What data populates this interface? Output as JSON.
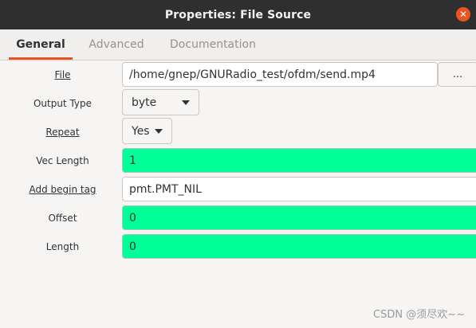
{
  "window": {
    "title": "Properties: File Source",
    "close_glyph": "✕"
  },
  "tabs": [
    {
      "label": "General",
      "active": true
    },
    {
      "label": "Advanced",
      "active": false
    },
    {
      "label": "Documentation",
      "active": false
    }
  ],
  "fields": {
    "file": {
      "label": "File",
      "value": "/home/gnep/GNURadio_test/ofdm/send.mp4",
      "browse_label": "..."
    },
    "output_type": {
      "label": "Output Type",
      "value": "byte"
    },
    "repeat": {
      "label": "Repeat",
      "value": "Yes"
    },
    "vec_length": {
      "label": "Vec Length",
      "value": "1"
    },
    "add_begin_tag": {
      "label": "Add begin tag",
      "value": "pmt.PMT_NIL"
    },
    "offset": {
      "label": "Offset",
      "value": "0"
    },
    "length": {
      "label": "Length",
      "value": "0"
    }
  },
  "colors": {
    "accent": "#e95420",
    "titlebar": "#2f2f2f",
    "highlight_field": "#00ff99"
  },
  "watermark": "CSDN @须尽欢~~"
}
